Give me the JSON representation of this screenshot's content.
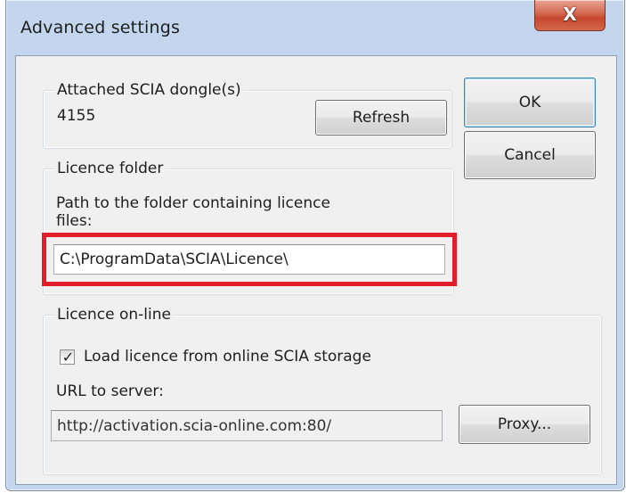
{
  "window": {
    "title": "Advanced settings",
    "close_icon": "close-icon"
  },
  "dongle_group": {
    "legend": "Attached SCIA dongle(s)",
    "value": "4155",
    "refresh_label": "Refresh"
  },
  "licence_folder_group": {
    "legend": "Licence folder",
    "description_line1": "Path to the folder containing licence",
    "description_line2": "files:",
    "path_value": "C:\\ProgramData\\SCIA\\Licence\\"
  },
  "licence_online_group": {
    "legend": "Licence on-line",
    "checkbox_label": "Load licence from online SCIA storage",
    "checkbox_checked": true,
    "url_label": "URL to server:",
    "url_value": "http://activation.scia-online.com:80/",
    "proxy_label": "Proxy..."
  },
  "actions": {
    "ok_label": "OK",
    "cancel_label": "Cancel"
  },
  "colors": {
    "highlight": "#e21e2d",
    "frame": "#c3d6ee",
    "client": "#f0f0f0"
  }
}
